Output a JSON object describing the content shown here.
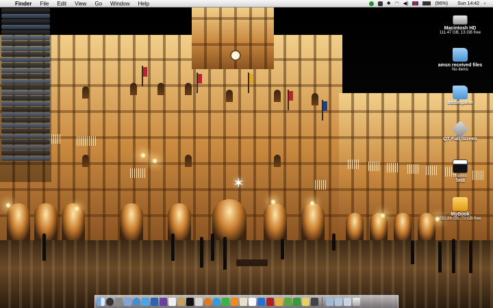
{
  "menubar": {
    "app_name": "Finder",
    "items": [
      "File",
      "Edit",
      "View",
      "Go",
      "Window",
      "Help"
    ],
    "battery": "(96%)",
    "clock": "Sun 14:42"
  },
  "desktop_icons": [
    {
      "label": "Macintosh HD",
      "sub": "111.47 GB, 13 GB free",
      "icon": "hard-drive-icon"
    },
    {
      "label": "amsn received files",
      "sub": "No items",
      "icon": "folder-icon"
    },
    {
      "label": "Incomplete",
      "sub": "",
      "icon": "folder-icon"
    },
    {
      "label": "QT Full Screen",
      "sub": "",
      "icon": "quicktime-icon"
    },
    {
      "label": "Test",
      "sub": "3 items",
      "icon": "clapboard-icon"
    },
    {
      "label": "MyBook",
      "sub": "232.88 GB, 72 GB free",
      "icon": "external-drive-icon"
    }
  ],
  "colors": {
    "menubar": "#e6e6e6",
    "apple": "#2a5db8",
    "building_light": "#f2cf8a",
    "sky": "#000000"
  },
  "dock_items": [
    "finder-icon",
    "dashboard-icon",
    "system-preferences-icon",
    "mail-icon",
    "safari-icon",
    "itunes-icon",
    "iphoto-icon",
    "imovie-icon",
    "calendar-icon",
    "address-book-icon",
    "terminal-icon",
    "quicktime-icon",
    "firefox-icon",
    "skype-icon",
    "adium-icon",
    "vlc-icon",
    "preview-icon",
    "textedit-icon",
    "itunes-store-icon",
    "photo-booth-icon",
    "garageband-icon",
    "utorrent-icon",
    "amsn-icon",
    "chess-icon",
    "activity-monitor-icon",
    "applications-folder-icon",
    "documents-folder-icon",
    "downloads-stack-icon",
    "trash-icon"
  ]
}
